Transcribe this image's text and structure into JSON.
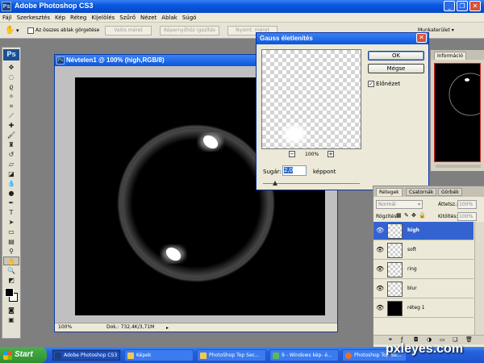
{
  "app": {
    "title": "Adobe Photoshop CS3",
    "logo": "Ps"
  },
  "menu": [
    "Fájl",
    "Szerkesztés",
    "Kép",
    "Réteg",
    "Kijelölés",
    "Szűrő",
    "Nézet",
    "Ablak",
    "Súgó"
  ],
  "options": {
    "scroll_all_label": "Az összes ablak görgetése",
    "btn_actual": "Valós méret",
    "btn_fit": "Képernyőhöz igazítás",
    "btn_print": "Nyomt. méret",
    "workspace": "Munkaterület"
  },
  "document": {
    "title": "Névtelen1 @ 100% (high,RGB/8)",
    "zoom": "100%",
    "doc_info": "Dok.: 732,4K/3,71M"
  },
  "dialog": {
    "title": "Gauss életlenítés",
    "ok": "OK",
    "cancel": "Mégse",
    "preview_label": "Előnézet",
    "zoom": "100%",
    "zoom_out": "−",
    "zoom_in": "+",
    "radius_label": "Sugár:",
    "radius_value": "2,0",
    "unit": "képpont"
  },
  "navigator": {
    "tab": "Információ"
  },
  "layers": {
    "tabs": [
      "Rétegek",
      "Csatornák",
      "Görbék"
    ],
    "blend_mode": "Normál",
    "opacity_label": "Áttetsz.:",
    "opacity": "100%",
    "lock_label": "Rögzítés:",
    "fill_label": "Kitöltés:",
    "fill": "100%",
    "items": [
      {
        "name": "high",
        "selected": true,
        "thumb": "transparent"
      },
      {
        "name": "soft",
        "selected": false,
        "thumb": "transparent"
      },
      {
        "name": "ring",
        "selected": false,
        "thumb": "transparent"
      },
      {
        "name": "blur",
        "selected": false,
        "thumb": "transparent"
      },
      {
        "name": "réteg 1",
        "selected": false,
        "thumb": "black"
      }
    ]
  },
  "taskbar": {
    "start": "Start",
    "items": [
      "Adobe Photoshop CS3",
      "Képek",
      "PhotoShop Top Sec...",
      "9 - Windows kép- é...",
      "Photoshop Top Se..."
    ]
  },
  "watermark": "pxleyes.com"
}
